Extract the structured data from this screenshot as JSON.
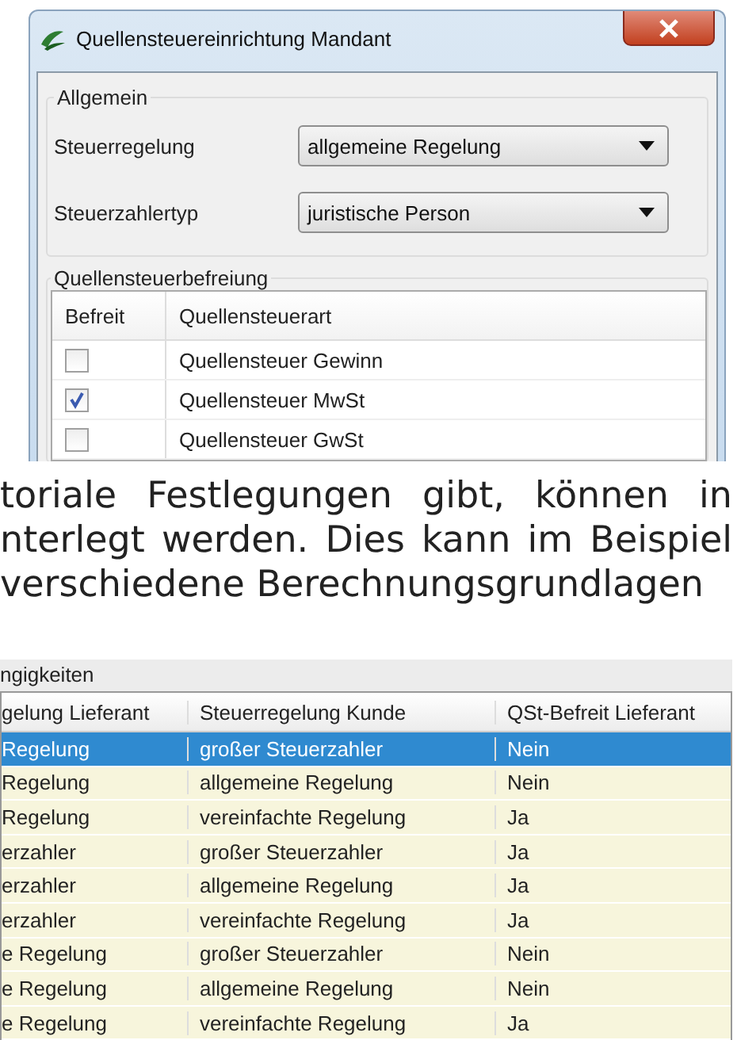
{
  "dialog": {
    "title": "Quellensteuereinrichtung Mandant",
    "general_group": {
      "title": "Allgemein",
      "fields": [
        {
          "label": "Steuerregelung",
          "value": "allgemeine Regelung"
        },
        {
          "label": "Steuerzahlertyp",
          "value": "juristische Person"
        }
      ]
    },
    "exemption_group": {
      "title": "Quellensteuerbefreiung",
      "columns": [
        "Befreit",
        "Quellensteuerart"
      ],
      "rows": [
        {
          "checked": false,
          "name": "Quellensteuer Gewinn"
        },
        {
          "checked": true,
          "name": "Quellensteuer MwSt"
        },
        {
          "checked": false,
          "name": "Quellensteuer GwSt"
        }
      ]
    }
  },
  "paragraph_lines": [
    "toriale Festlegungen gibt, können in",
    "nterlegt werden. Dies kann im Beispiel",
    "verschiedene Berechnungsgrundlagen"
  ],
  "dependencies_panel": {
    "title": "ngigkeiten",
    "columns": [
      "gelung Lieferant",
      "Steuerregelung Kunde",
      "QSt-Befreit Lieferant"
    ],
    "rows": [
      {
        "selected": true,
        "cells": [
          "Regelung",
          "großer Steuerzahler",
          "Nein"
        ]
      },
      {
        "selected": false,
        "cells": [
          "Regelung",
          "allgemeine Regelung",
          "Nein"
        ]
      },
      {
        "selected": false,
        "cells": [
          "Regelung",
          "vereinfachte Regelung",
          "Ja"
        ]
      },
      {
        "selected": false,
        "cells": [
          "erzahler",
          "großer Steuerzahler",
          "Ja"
        ]
      },
      {
        "selected": false,
        "cells": [
          "erzahler",
          "allgemeine Regelung",
          "Ja"
        ]
      },
      {
        "selected": false,
        "cells": [
          "erzahler",
          "vereinfachte Regelung",
          "Ja"
        ]
      },
      {
        "selected": false,
        "cells": [
          "e Regelung",
          "großer Steuerzahler",
          "Nein"
        ]
      },
      {
        "selected": false,
        "cells": [
          "e Regelung",
          "allgemeine Regelung",
          "Nein"
        ]
      },
      {
        "selected": false,
        "cells": [
          "e Regelung",
          "vereinfachte Regelung",
          "Ja"
        ]
      }
    ]
  }
}
